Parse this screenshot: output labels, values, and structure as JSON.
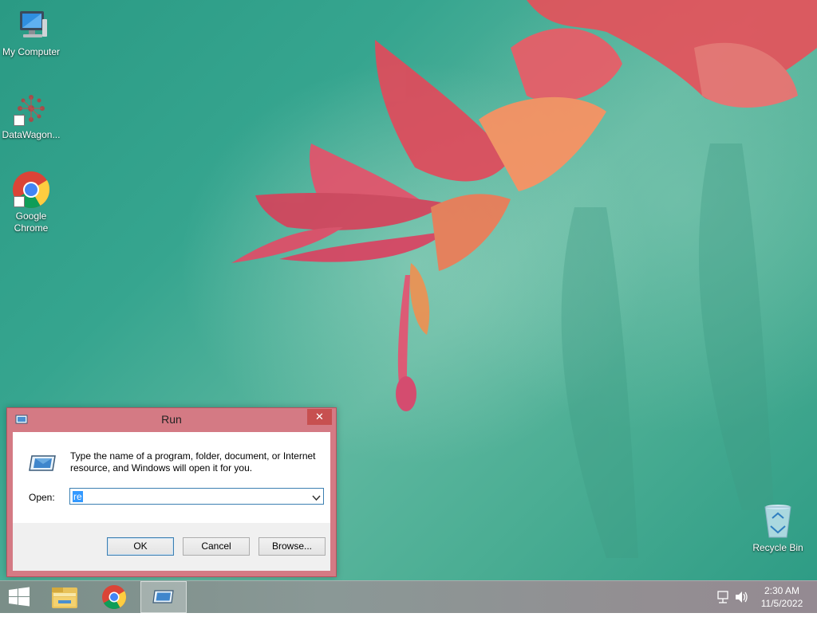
{
  "desktop": {
    "icons": [
      {
        "label": "My Computer"
      },
      {
        "label": "DataWagon..."
      },
      {
        "label": "Google Chrome"
      },
      {
        "label": "Recycle Bin"
      }
    ]
  },
  "run_dialog": {
    "title": "Run",
    "close_glyph": "✕",
    "description": "Type the name of a program, folder, document, or Internet resource, and Windows will open it for you.",
    "open_label": "Open:",
    "open_value": "re",
    "ok_label": "OK",
    "cancel_label": "Cancel",
    "browse_label": "Browse..."
  },
  "taskbar": {
    "items": [
      "windows-logo-icon",
      "file-explorer-icon",
      "chrome-icon",
      "run-icon"
    ],
    "tray_icons": [
      "network-icon",
      "volume-icon"
    ],
    "time": "2:30 AM",
    "date": "11/5/2022"
  },
  "colors": {
    "dialog_frame": "#d47a84",
    "close_button": "#c75050",
    "selection": "#3399ff",
    "accent_blue": "#3c7fb1"
  }
}
